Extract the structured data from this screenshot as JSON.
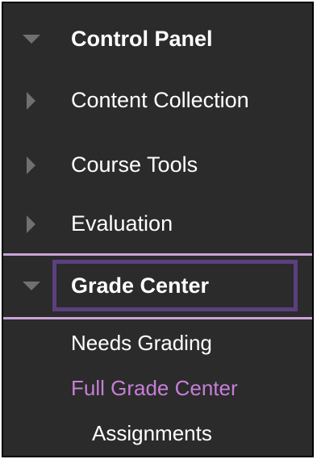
{
  "menu": {
    "control_panel": {
      "label": "Control Panel",
      "icon": "triangle-down-icon"
    },
    "items": [
      {
        "label": "Content Collection",
        "icon": "triangle-right-icon"
      },
      {
        "label": "Course Tools",
        "icon": "triangle-right-icon"
      },
      {
        "label": "Evaluation",
        "icon": "triangle-right-icon"
      }
    ],
    "grade_center": {
      "label": "Grade Center",
      "icon": "triangle-down-icon"
    },
    "grade_center_items": [
      {
        "label": "Needs Grading"
      },
      {
        "label": "Full Grade Center",
        "active": true
      },
      {
        "label": "Assignments"
      }
    ]
  },
  "colors": {
    "background": "#2b2b2b",
    "text": "#ffffff",
    "triangle": "#707070",
    "separator": "#c9a3d6",
    "focus_border": "#5b3f7f",
    "active_link": "#c57fd6"
  }
}
